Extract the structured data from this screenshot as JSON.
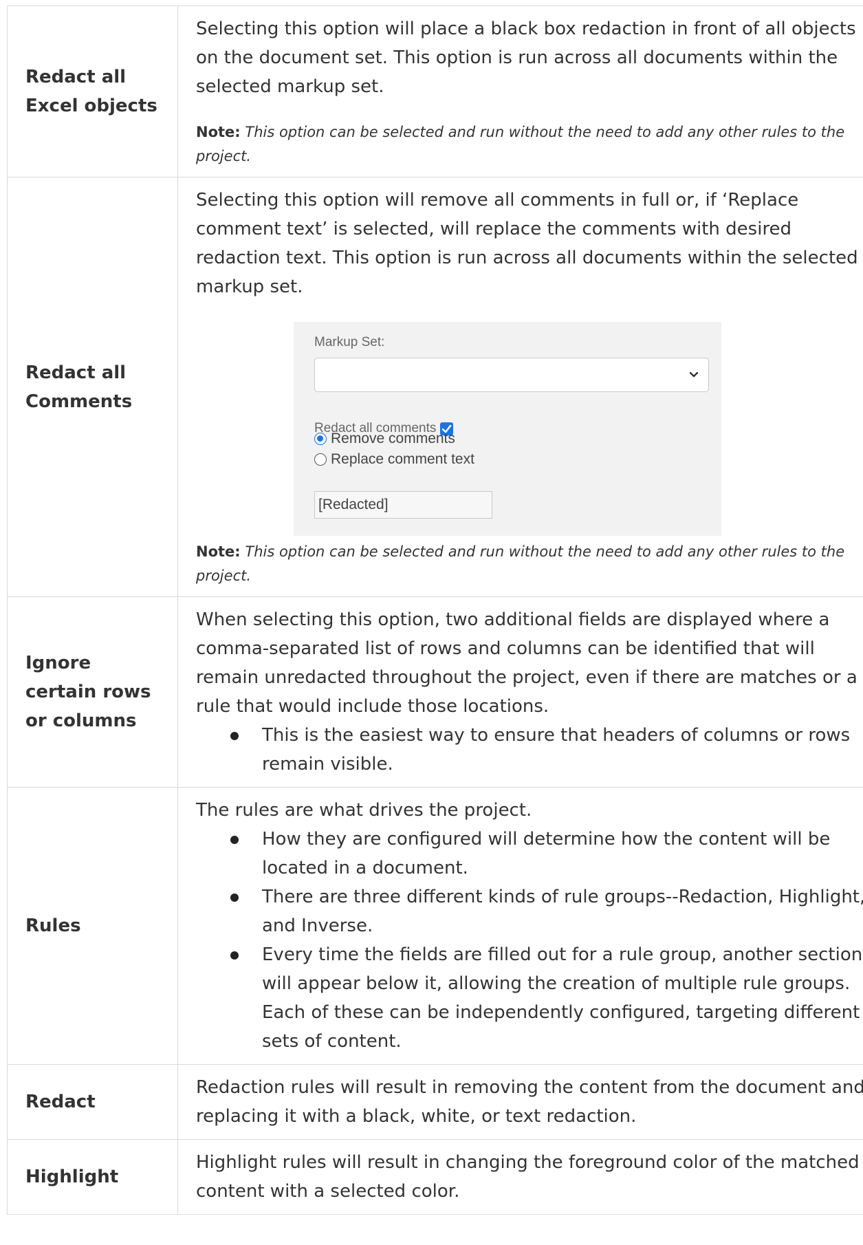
{
  "rows": [
    {
      "label": "Redact all Excel objects",
      "description": "Selecting this option will place a black box redaction in front of all objects on the document set. This option is run across all documents within the selected markup set.",
      "note_label": "Note:",
      "note_text": "This option can be selected and run without the need to add any other rules to the project."
    },
    {
      "label": "Redact all Comments",
      "description": "Selecting this option will remove all comments in full or, if ‘Replace comment text’ is selected, will replace the comments with desired redaction text. This option is run across all documents within the selected markup set.",
      "form": {
        "markup_set_label": "Markup Set:",
        "markup_set_value": "",
        "redact_all_comments_label": "Redact all comments",
        "redact_all_comments_checked": true,
        "option_remove": "Remove comments",
        "option_replace": "Replace comment text",
        "selected_option": "Remove comments",
        "replace_text_value": "[Redacted]"
      },
      "note_label": "Note:",
      "note_text": "This option can be selected and run without the need to add any other rules to the project."
    },
    {
      "label": "Ignore certain rows or columns",
      "description": "When selecting this option, two additional fields are displayed where a comma-separated list of rows and columns can be identified that will remain unredacted throughout the project, even if there are matches or a rule that would include those locations.",
      "bullets": [
        "This is the easiest way to ensure that headers of columns or rows remain visible."
      ]
    },
    {
      "label": "Rules",
      "description": "The rules are what drives the project.",
      "bullets": [
        "How they are configured will determine how the content will be located in a document.",
        "There are three different kinds of rule groups--Redaction, Highlight, and Inverse.",
        "Every time the fields are filled out for a rule group, another section will appear below it, allowing the creation of multiple rule groups. Each of these can be independently configured, targeting different sets of content."
      ]
    },
    {
      "label": "Redact",
      "description": "Redaction rules will result in removing the content from the document and replacing it with a black, white, or text redaction."
    },
    {
      "label": "Highlight",
      "description": "Highlight rules will result in changing the foreground color of the matched content with a selected color."
    }
  ],
  "colors": {
    "border": "#d9d9d9",
    "text": "#333333",
    "accent": "#1a73e8",
    "form_bg": "#f2f2f2"
  },
  "icons": [
    "chevron-down-icon",
    "checkbox-checked-icon",
    "radio-selected-icon",
    "radio-unselected-icon",
    "bullet-icon"
  ]
}
